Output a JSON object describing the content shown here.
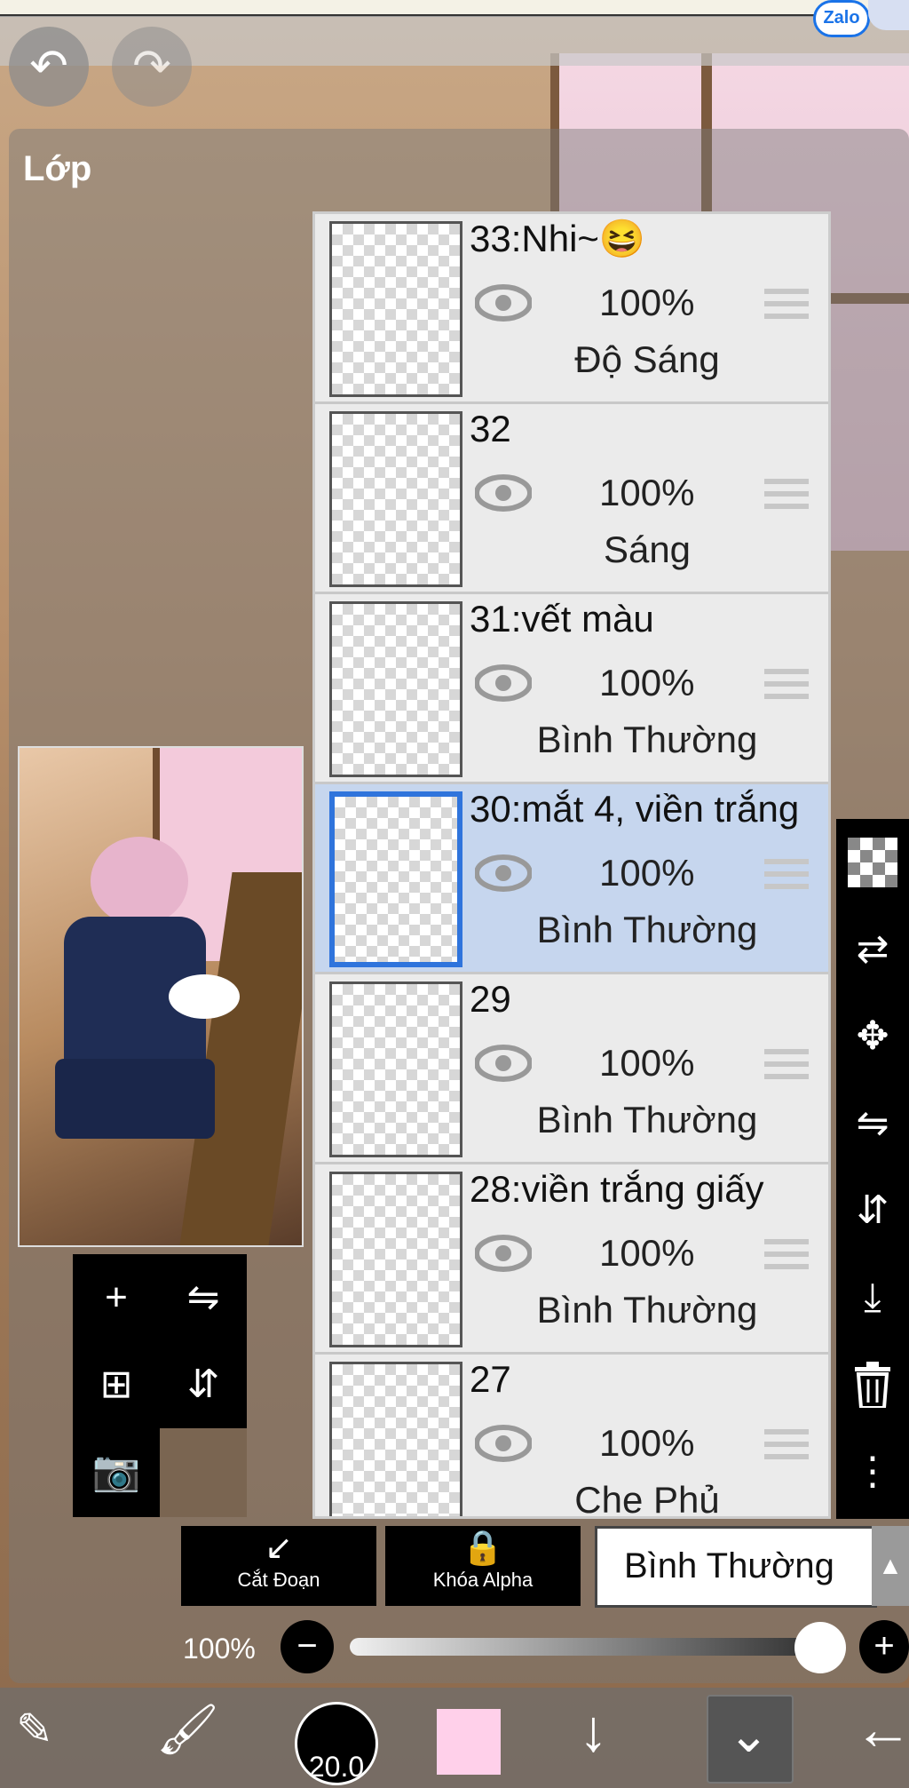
{
  "app": {
    "zalo_label": "Zalo",
    "colors": {
      "selected_row": "#c6d6ee",
      "selected_border": "#2f74dc",
      "brush_color": "#ffd0ea"
    }
  },
  "top_controls": {
    "undo_icon": "↶",
    "redo_icon": "↷"
  },
  "panel": {
    "title": "Lớp"
  },
  "layers": [
    {
      "name": "33:Nhi~😆",
      "opacity": "100%",
      "blend": "Độ Sáng",
      "selected": false
    },
    {
      "name": "32",
      "opacity": "100%",
      "blend": "Sáng",
      "selected": false
    },
    {
      "name": "31:vết màu",
      "opacity": "100%",
      "blend": "Bình Thường",
      "selected": false
    },
    {
      "name": "30:mắt 4, viền trắng",
      "opacity": "100%",
      "blend": "Bình Thường",
      "selected": true
    },
    {
      "name": "29",
      "opacity": "100%",
      "blend": "Bình Thường",
      "selected": false
    },
    {
      "name": "28:viền trắng giấy",
      "opacity": "100%",
      "blend": "Bình Thường",
      "selected": false
    },
    {
      "name": "27",
      "opacity": "100%",
      "blend": "Che Phủ",
      "selected": false
    }
  ],
  "layer_tools": {
    "add": "+",
    "add_copy": "⊞",
    "camera": "📷",
    "flip_h": "⇋",
    "flip_v": "⇵"
  },
  "right_tools": [
    "checker-icon",
    "transfer-icon",
    "move-icon",
    "flip-horizontal-icon",
    "flip-vertical-icon",
    "merge-down-icon",
    "trash-icon",
    "more-icon"
  ],
  "controls": {
    "clip_label": "Cắt Đoạn",
    "alpha_lock_label": "Khóa Alpha",
    "blend_mode": "Bình Thường",
    "opacity_value": "100%",
    "opacity_fraction": 1.0,
    "minus": "−",
    "plus": "+"
  },
  "bottom_bar": {
    "brush_size": "20.0"
  }
}
